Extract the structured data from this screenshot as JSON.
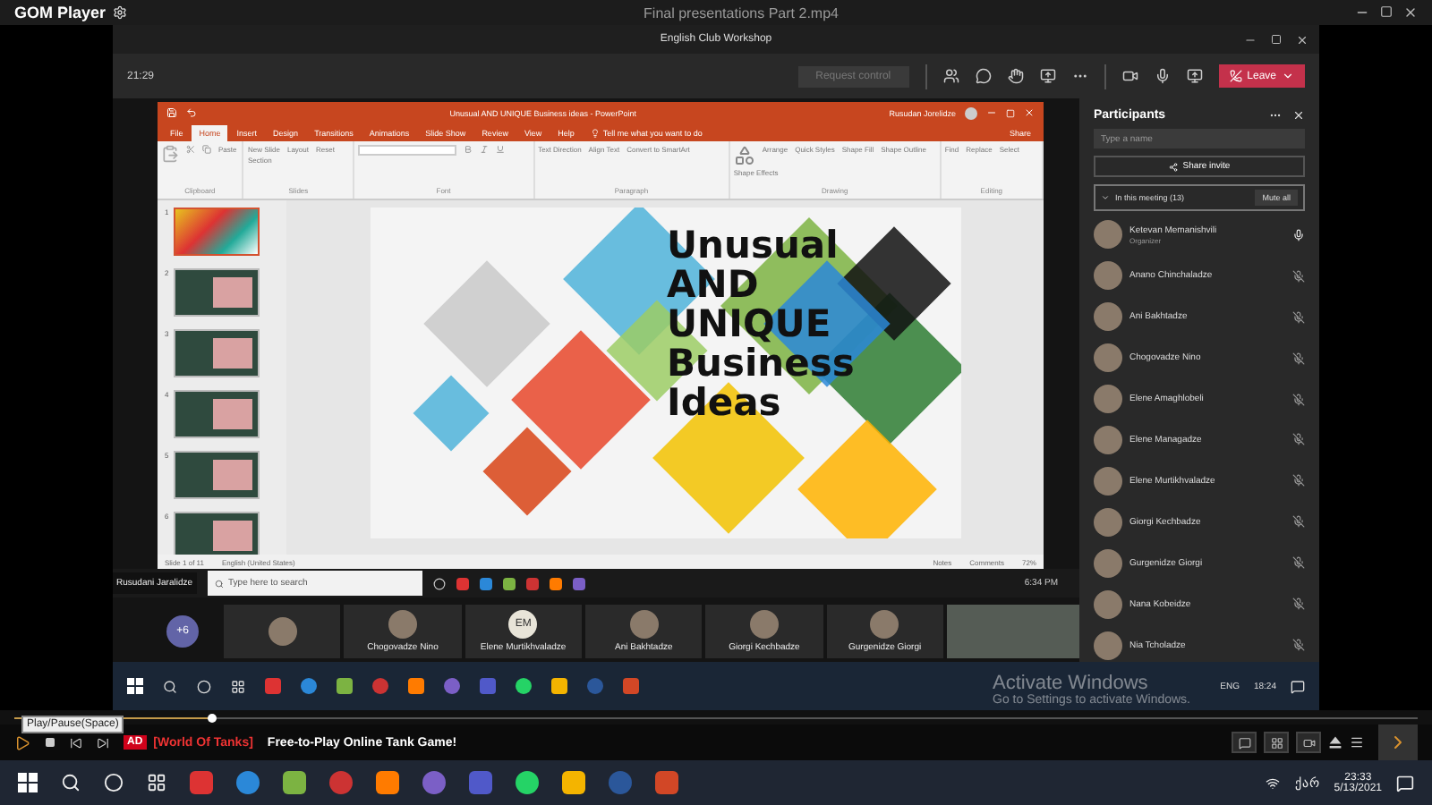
{
  "player": {
    "brand": "GOM Player",
    "file_title": "Final presentations Part 2.mp4"
  },
  "meeting": {
    "title": "English Club Workshop",
    "elapsed": "21:29",
    "request_control": "Request control",
    "leave": "Leave"
  },
  "presentation": {
    "title": "Unusual AND UNIQUE Business ideas - PowerPoint",
    "user": "Rusudan Jorelidze",
    "tell_me": "Tell me what you want to do",
    "share": "Share",
    "tabs": [
      {
        "label": "File",
        "selected": false
      },
      {
        "label": "Home",
        "selected": true
      },
      {
        "label": "Insert",
        "selected": false
      },
      {
        "label": "Design",
        "selected": false
      },
      {
        "label": "Transitions",
        "selected": false
      },
      {
        "label": "Animations",
        "selected": false
      },
      {
        "label": "Slide Show",
        "selected": false
      },
      {
        "label": "Review",
        "selected": false
      },
      {
        "label": "View",
        "selected": false
      },
      {
        "label": "Help",
        "selected": false
      }
    ],
    "ribbon_groups": [
      {
        "label": "Clipboard",
        "buttons": [
          "Paste"
        ]
      },
      {
        "label": "Slides",
        "buttons": [
          "New Slide",
          "Layout",
          "Reset",
          "Section"
        ]
      },
      {
        "label": "Font"
      },
      {
        "label": "Paragraph",
        "buttons": [
          "Text Direction",
          "Align Text",
          "Convert to SmartArt"
        ]
      },
      {
        "label": "Drawing",
        "buttons": [
          "Arrange",
          "Quick Styles",
          "Shape Fill",
          "Shape Outline",
          "Shape Effects"
        ]
      },
      {
        "label": "Editing",
        "buttons": [
          "Find",
          "Replace",
          "Select"
        ]
      }
    ],
    "slides": [
      {
        "number": "1",
        "selected": true
      },
      {
        "number": "2",
        "selected": false
      },
      {
        "number": "3",
        "selected": false
      },
      {
        "number": "4",
        "selected": false
      },
      {
        "number": "5",
        "selected": false
      },
      {
        "number": "6",
        "selected": false
      }
    ],
    "slide_title_lines": [
      "Unusual",
      "AND",
      "UNIQUE",
      "Business",
      "Ideas"
    ],
    "status": {
      "slide_count": "Slide 1 of 11",
      "language": "English (United States)",
      "notes": "Notes",
      "comments": "Comments",
      "zoom": "72%"
    }
  },
  "shared_taskbar": {
    "presenter": "Rusudani Jaralidze",
    "search_placeholder": "Type here to search",
    "time": "6:34 PM"
  },
  "participants": {
    "title": "Participants",
    "search_placeholder": "Type a name",
    "share_invite": "Share invite",
    "section": "In this meeting (13)",
    "expanded": true,
    "mute_all": "Mute all",
    "people": [
      {
        "name": "Ketevan Memanishvili",
        "role": "Organizer",
        "muted": false
      },
      {
        "name": "Anano Chinchaladze",
        "muted": true
      },
      {
        "name": "Ani Bakhtadze",
        "muted": true
      },
      {
        "name": "Chogovadze Nino",
        "muted": true
      },
      {
        "name": "Elene Amaghlobeli",
        "muted": true
      },
      {
        "name": "Elene Managadze",
        "muted": true
      },
      {
        "name": "Elene Murtikhvaladze",
        "muted": true
      },
      {
        "name": "Giorgi Kechbadze",
        "muted": true
      },
      {
        "name": "Gurgenidze Giorgi",
        "muted": true
      },
      {
        "name": "Nana Kobeidze",
        "muted": true
      },
      {
        "name": "Nia Tcholadze",
        "muted": true
      }
    ]
  },
  "video_strip": {
    "overflow": "+6",
    "tiles": [
      {
        "kind": "avatar"
      },
      {
        "kind": "avatar",
        "name": "Chogovadze Nino"
      },
      {
        "kind": "initials",
        "initials": "EM",
        "name": "Elene Murtikhvaladze"
      },
      {
        "kind": "avatar",
        "name": "Ani Bakhtadze"
      },
      {
        "kind": "avatar",
        "name": "Giorgi Kechbadze"
      },
      {
        "kind": "avatar",
        "name": "Gurgenidze Giorgi"
      },
      {
        "kind": "video"
      }
    ]
  },
  "inner_taskbar": {
    "language": "ENG",
    "time": "18:24"
  },
  "playback": {
    "level": 0.14,
    "tooltip": "Play/Pause(Space)",
    "ad_badge": "AD",
    "ad_sponsor": "[World Of Tanks]",
    "ad_text": "Free-to-Play Online Tank Game!"
  },
  "taskbar": {
    "language": "ქარ",
    "time": "23:33",
    "date": "5/13/2021"
  },
  "activation_notices": [
    {
      "heading": "Activate Windows",
      "detail": "Go to Settings to activate Windows."
    }
  ]
}
